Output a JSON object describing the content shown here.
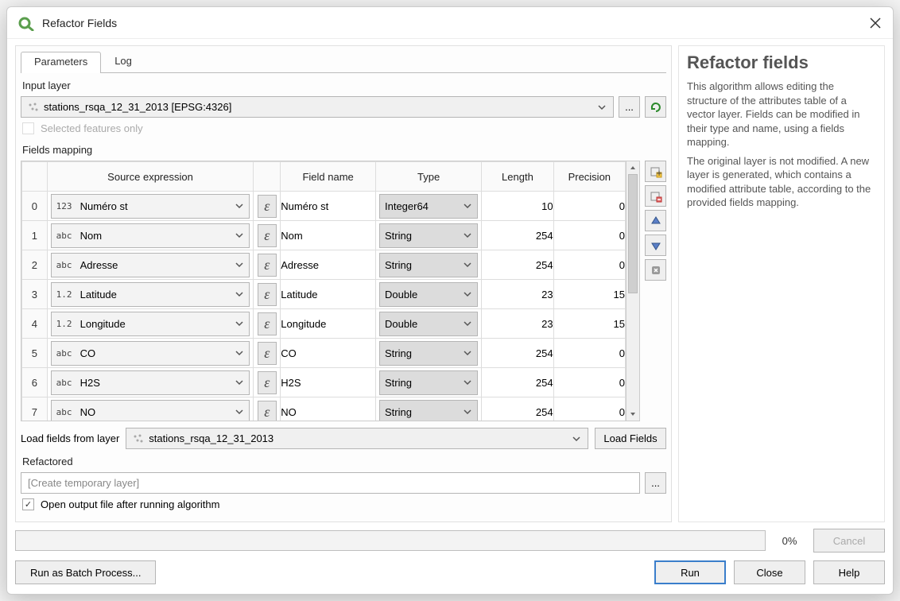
{
  "window_title": "Refactor Fields",
  "tabs": {
    "parameters": "Parameters",
    "log": "Log"
  },
  "input_layer": {
    "label": "Input layer",
    "value": "stations_rsqa_12_31_2013 [EPSG:4326]",
    "selected_only_label": "Selected features only"
  },
  "fields_mapping": {
    "label": "Fields mapping",
    "headers": {
      "source": "Source expression",
      "field_name": "Field name",
      "type": "Type",
      "length": "Length",
      "precision": "Precision"
    },
    "rows": [
      {
        "idx": "0",
        "source_prefix": "123",
        "source_name": "Numéro st",
        "field_name": "Numéro st",
        "type": "Integer64",
        "length": "10",
        "precision": "0"
      },
      {
        "idx": "1",
        "source_prefix": "abc",
        "source_name": "Nom",
        "field_name": "Nom",
        "type": "String",
        "length": "254",
        "precision": "0"
      },
      {
        "idx": "2",
        "source_prefix": "abc",
        "source_name": "Adresse",
        "field_name": "Adresse",
        "type": "String",
        "length": "254",
        "precision": "0"
      },
      {
        "idx": "3",
        "source_prefix": "1.2",
        "source_name": "Latitude",
        "field_name": "Latitude",
        "type": "Double",
        "length": "23",
        "precision": "15"
      },
      {
        "idx": "4",
        "source_prefix": "1.2",
        "source_name": "Longitude",
        "field_name": "Longitude",
        "type": "Double",
        "length": "23",
        "precision": "15"
      },
      {
        "idx": "5",
        "source_prefix": "abc",
        "source_name": "CO",
        "field_name": "CO",
        "type": "String",
        "length": "254",
        "precision": "0"
      },
      {
        "idx": "6",
        "source_prefix": "abc",
        "source_name": "H2S",
        "field_name": "H2S",
        "type": "String",
        "length": "254",
        "precision": "0"
      },
      {
        "idx": "7",
        "source_prefix": "abc",
        "source_name": "NO",
        "field_name": "NO",
        "type": "String",
        "length": "254",
        "precision": "0"
      }
    ]
  },
  "load_from_layer": {
    "label": "Load fields from layer",
    "value": "stations_rsqa_12_31_2013",
    "button": "Load Fields"
  },
  "refactored": {
    "label": "Refactored",
    "placeholder": "[Create temporary layer]",
    "open_after_label": "Open output file after running algorithm"
  },
  "side_icons": {
    "add": "add-field-icon",
    "delete": "delete-field-icon",
    "up": "move-up-icon",
    "down": "move-down-icon",
    "reset": "reset-icon"
  },
  "help": {
    "title": "Refactor fields",
    "para1": "This algorithm allows editing the structure of the attributes table of a vector layer. Fields can be modified in their type and name, using a fields mapping.",
    "para2": "The original layer is not modified. A new layer is generated, which contains a modified attribute table, according to the provided fields mapping."
  },
  "progress": {
    "percent": "0%"
  },
  "buttons": {
    "cancel": "Cancel",
    "batch": "Run as Batch Process...",
    "run": "Run",
    "close": "Close",
    "help": "Help"
  },
  "glyphs": {
    "eps": "ε",
    "ellipsis": "..."
  }
}
